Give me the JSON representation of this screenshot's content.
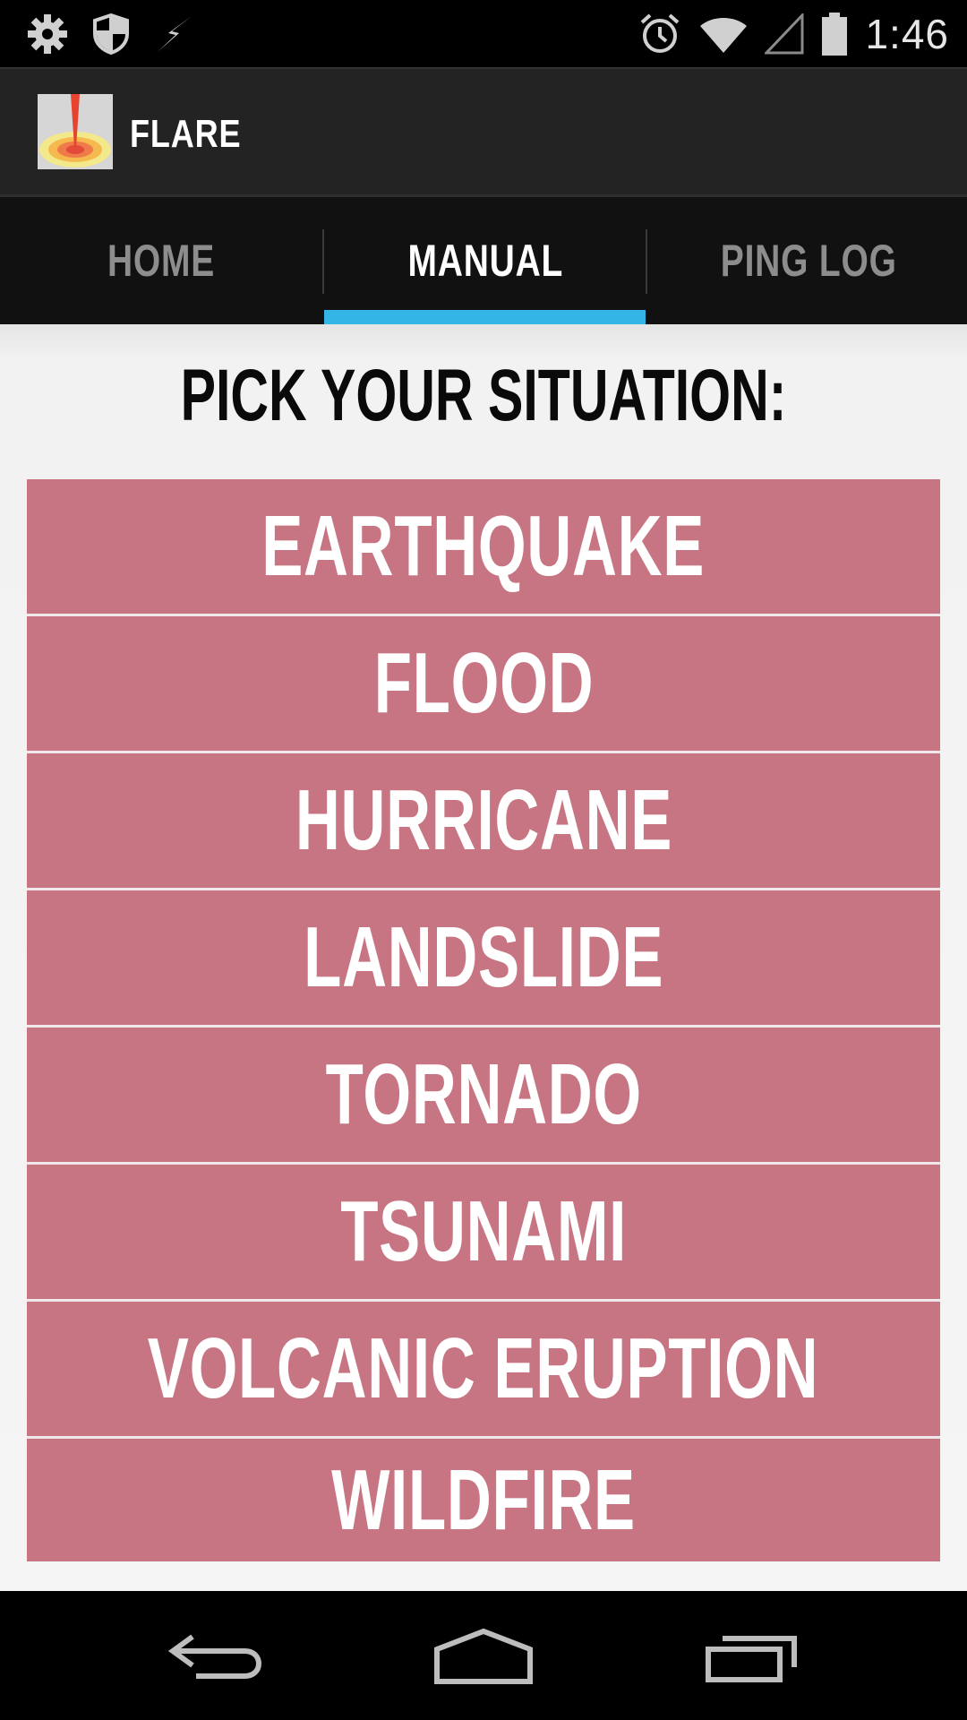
{
  "status_bar": {
    "time": "1:46",
    "left_icons": [
      "settings-gear-icon",
      "shield-icon",
      "lightning-icon"
    ],
    "right_icons": [
      "alarm-icon",
      "wifi-icon",
      "cell-signal-icon",
      "battery-icon"
    ]
  },
  "app": {
    "title": "FLARE",
    "icon": "flare-app-icon"
  },
  "tabs": [
    {
      "label": "HOME",
      "active": false
    },
    {
      "label": "MANUAL",
      "active": true
    },
    {
      "label": "PING LOG",
      "active": false
    }
  ],
  "accent_color": "#33b5e5",
  "button_color": "#c77582",
  "heading": "PICK YOUR SITUATION:",
  "situations": [
    "EARTHQUAKE",
    "FLOOD",
    "HURRICANE",
    "LANDSLIDE",
    "TORNADO",
    "TSUNAMI",
    "VOLCANIC ERUPTION",
    "WILDFIRE"
  ],
  "nav_bar": {
    "buttons": [
      "back-icon",
      "home-icon",
      "recent-apps-icon"
    ]
  }
}
